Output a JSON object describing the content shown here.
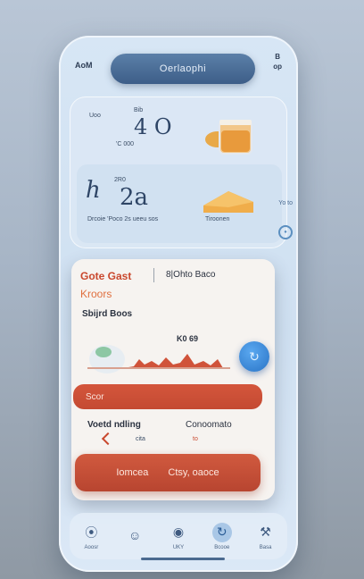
{
  "status": {
    "left": "AoM",
    "right_top": "B",
    "right_bottom": "op"
  },
  "header": {
    "title": "Oerlaophi"
  },
  "weather_card": {
    "label_a": "Uoo",
    "label_b": "Bib",
    "value": "4 O",
    "note": "'C 000"
  },
  "stats_card": {
    "label": "2R0",
    "value": "2a",
    "caption": "Drcoie 'Poco 2s ueeu sos",
    "side_label": "Tiroonen"
  },
  "side": {
    "label": "Yo to",
    "icon": "info-icon"
  },
  "main": {
    "title_left": "Gote Gast",
    "title_right": "8|Ohto Baco",
    "subtitle_red": "Kroors",
    "section_label": "Sbijrd Boos",
    "chart_label": "K0 69",
    "orange_bar_label": "Scor",
    "stat_left": "Voetd ndling",
    "stat_right": "Conoomato",
    "stat_left_small": "cita",
    "stat_right_small": "to",
    "button_left": "Iomcea",
    "button_right": "Ctsy, oaoce"
  },
  "tabs": [
    {
      "label": "Aoosr",
      "icon": "home-icon"
    },
    {
      "label": "",
      "icon": "person-icon"
    },
    {
      "label": "UKY",
      "icon": "globe-icon"
    },
    {
      "label": "Bcooe",
      "icon": "refresh-icon",
      "active": true
    },
    {
      "label": "Basa",
      "icon": "figure-icon"
    }
  ],
  "colors": {
    "accent": "#c9482e",
    "primary": "#3d5e88",
    "blue": "#2a74c6"
  }
}
